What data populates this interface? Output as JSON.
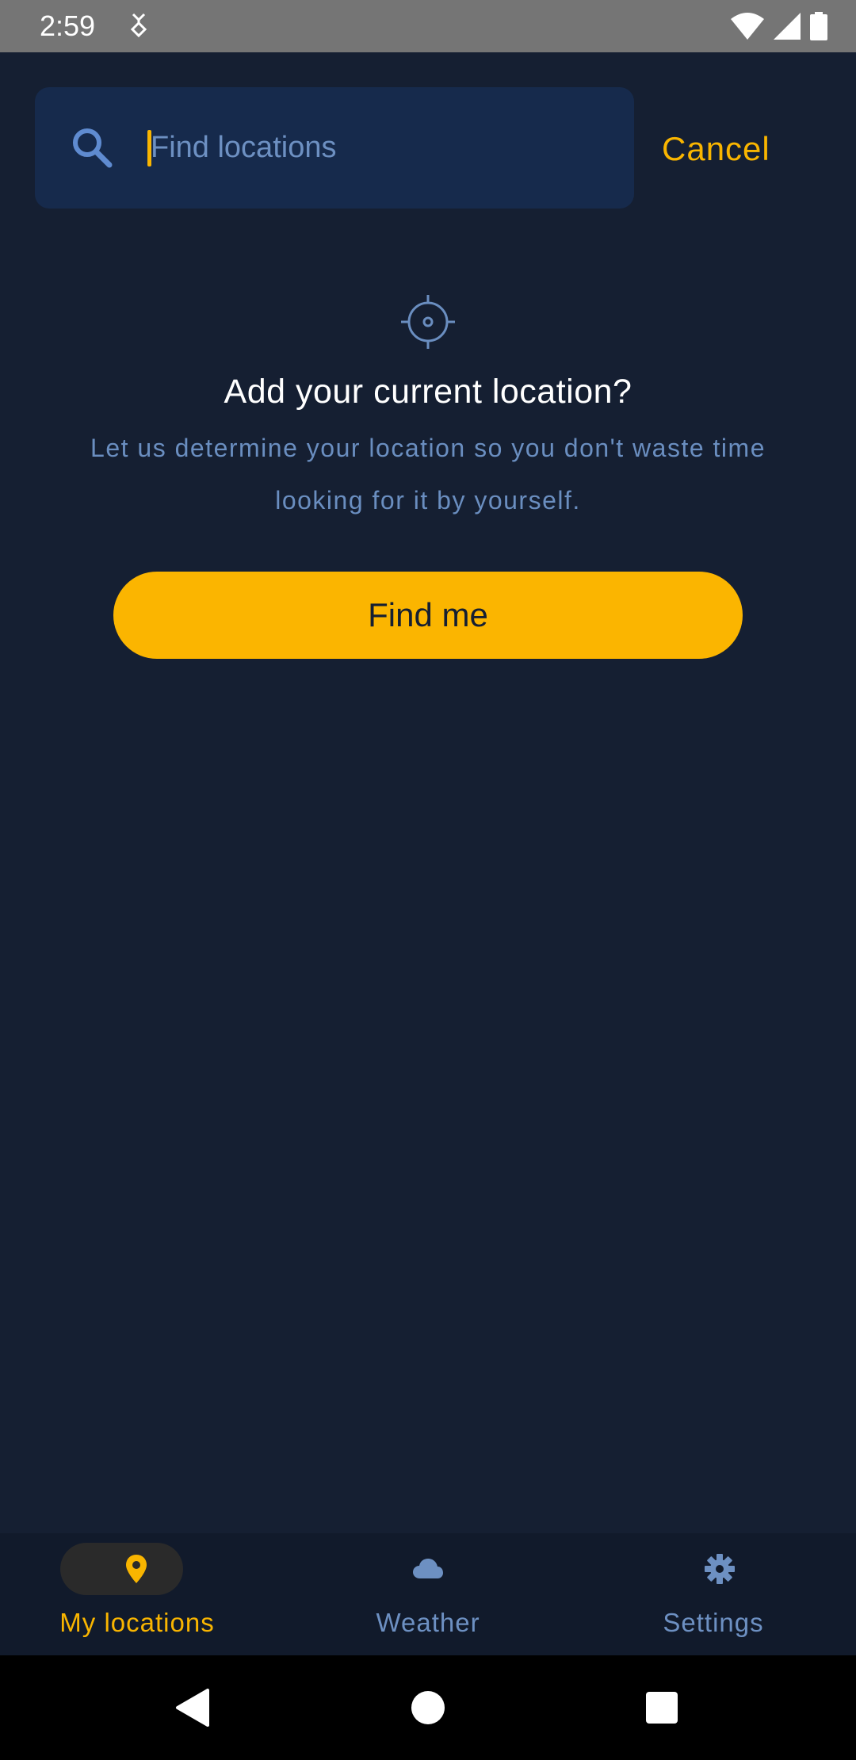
{
  "status_bar": {
    "time": "2:59",
    "icons": [
      "notification-app-icon",
      "wifi-icon",
      "cellular-signal-icon",
      "battery-icon"
    ]
  },
  "search": {
    "placeholder": "Find locations",
    "value": "",
    "cancel_label": "Cancel",
    "icon": "search-icon"
  },
  "prompt": {
    "icon": "crosshair-icon",
    "title": "Add your current location?",
    "description": "Let us determine your location so you don't waste time looking for it by yourself.",
    "button_label": "Find me"
  },
  "bottom_nav": {
    "items": [
      {
        "label": "My locations",
        "icon": "location-pin-icon",
        "selected": true
      },
      {
        "label": "Weather",
        "icon": "cloud-icon",
        "selected": false
      },
      {
        "label": "Settings",
        "icon": "gear-icon",
        "selected": false
      }
    ]
  },
  "system_nav": {
    "buttons": [
      "back-icon",
      "home-icon",
      "recents-icon"
    ]
  },
  "colors": {
    "background": "#151f32",
    "accent": "#fbb500",
    "search_field": "#162a4c",
    "secondary_text": "#6a8ec0",
    "inactive_nav": "#6d90c2",
    "nav_background": "#111a2b",
    "status_bar": "#757575"
  }
}
